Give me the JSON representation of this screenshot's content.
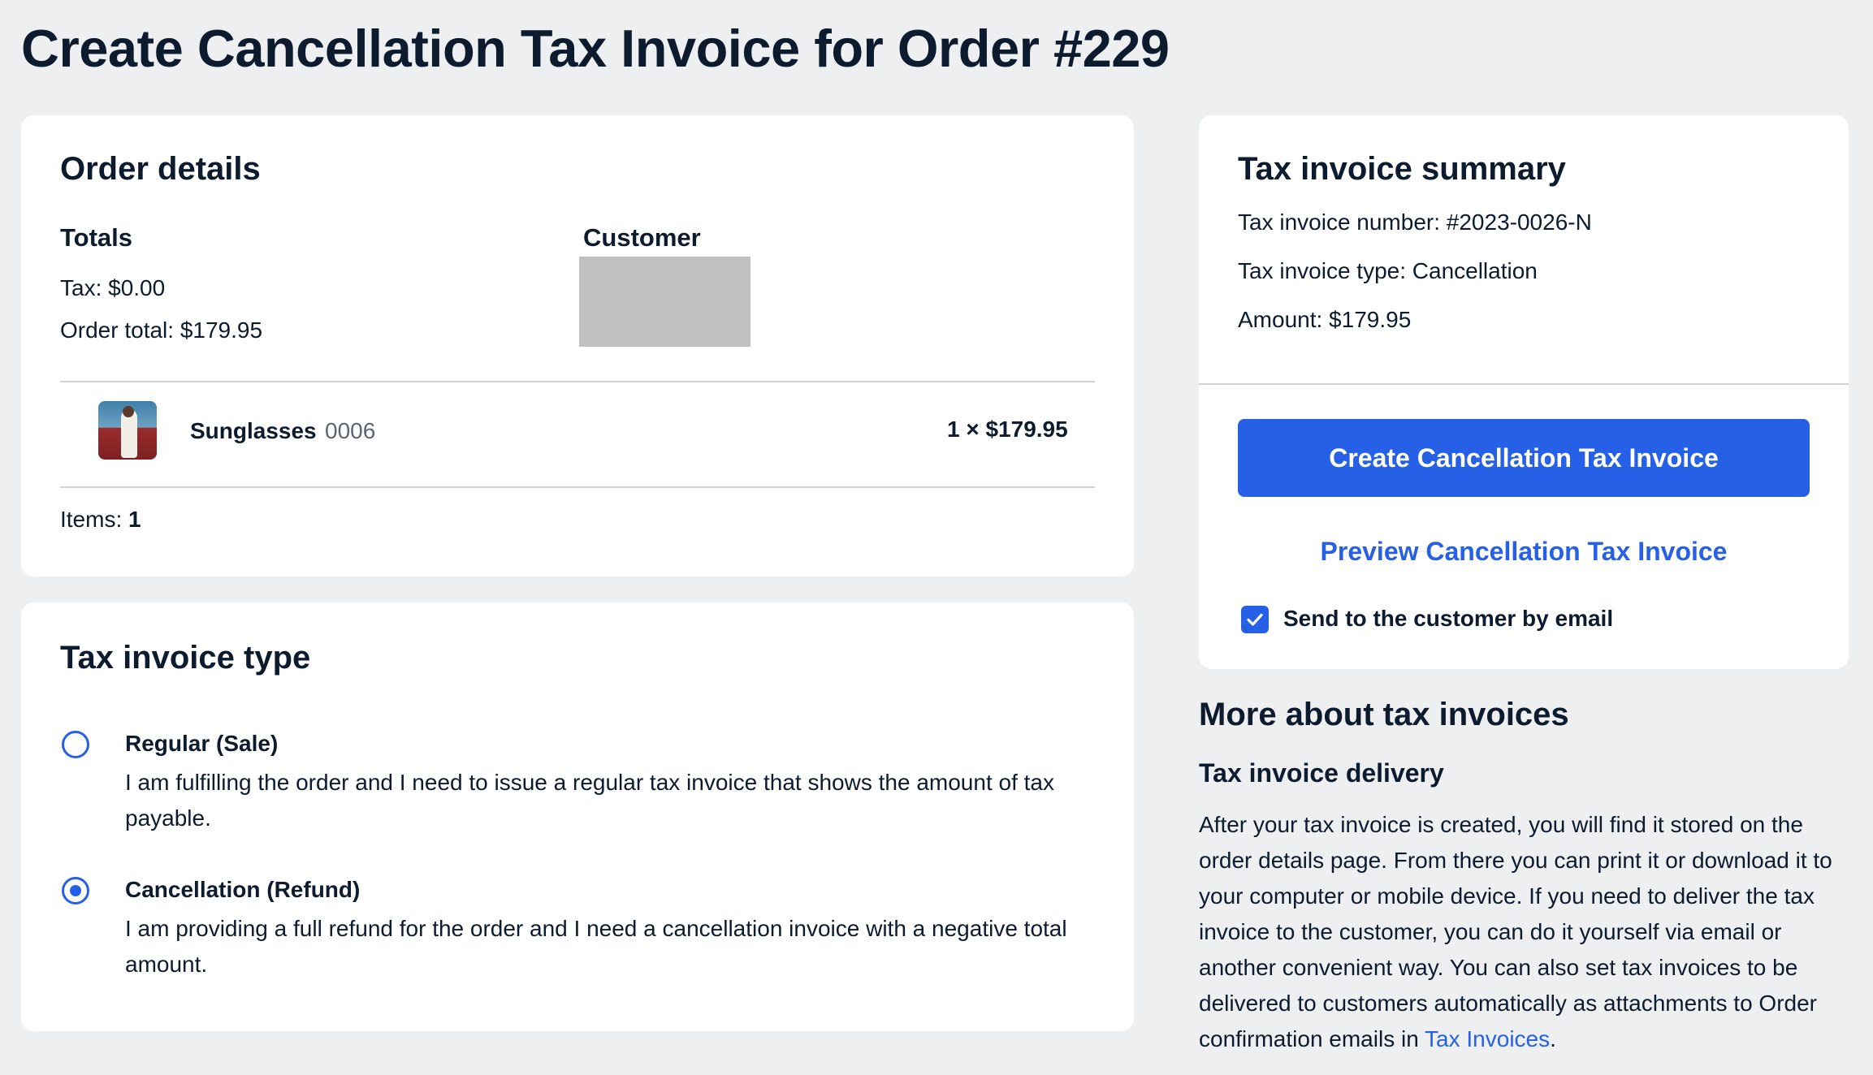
{
  "page": {
    "title": "Create Cancellation Tax Invoice for Order #229"
  },
  "order_details": {
    "title": "Order details",
    "totals_heading": "Totals",
    "tax_line": "Tax: $0.00",
    "order_total_line": "Order total: $179.95",
    "customer_heading": "Customer",
    "item": {
      "name": "Sunglasses",
      "sku": "0006",
      "qty_price": "1 × $179.95"
    },
    "items_label": "Items: ",
    "items_count": "1"
  },
  "tax_invoice_type": {
    "title": "Tax invoice type",
    "options": [
      {
        "label": "Regular (Sale)",
        "description": "I am fulfilling the order and I need to issue a regular tax invoice that shows the amount of tax payable.",
        "selected": false
      },
      {
        "label": "Cancellation (Refund)",
        "description": "I am providing a full refund for the order and I need a cancellation invoice with a negative total amount.",
        "selected": true
      }
    ]
  },
  "summary": {
    "title": "Tax invoice summary",
    "number_line": "Tax invoice number: #2023-0026-N",
    "type_line": "Tax invoice type: Cancellation",
    "amount_line": "Amount: $179.95",
    "create_button": "Create Cancellation Tax Invoice",
    "preview_link": "Preview Cancellation Tax Invoice",
    "send_email_label": "Send to the customer by email",
    "send_email_checked": true
  },
  "more_about": {
    "heading": "More about tax invoices",
    "subheading": "Tax invoice delivery",
    "body_text": "After your tax invoice is created, you will find it stored on the order details page. From there you can print it or download it to your computer or mobile device. If you need to deliver the tax invoice to the customer, you can do it yourself via email or another convenient way. You can also set tax invoices to be delivered to customers automatically as attachments to Order confirmation emails in ",
    "link_text": "Tax Invoices",
    "body_end": "."
  },
  "colors": {
    "accent": "#2660e6",
    "background": "#eeeff1",
    "text": "#0d1b2e",
    "muted": "#5b6675"
  },
  "icons": [
    "check-icon",
    "product-thumbnail"
  ]
}
